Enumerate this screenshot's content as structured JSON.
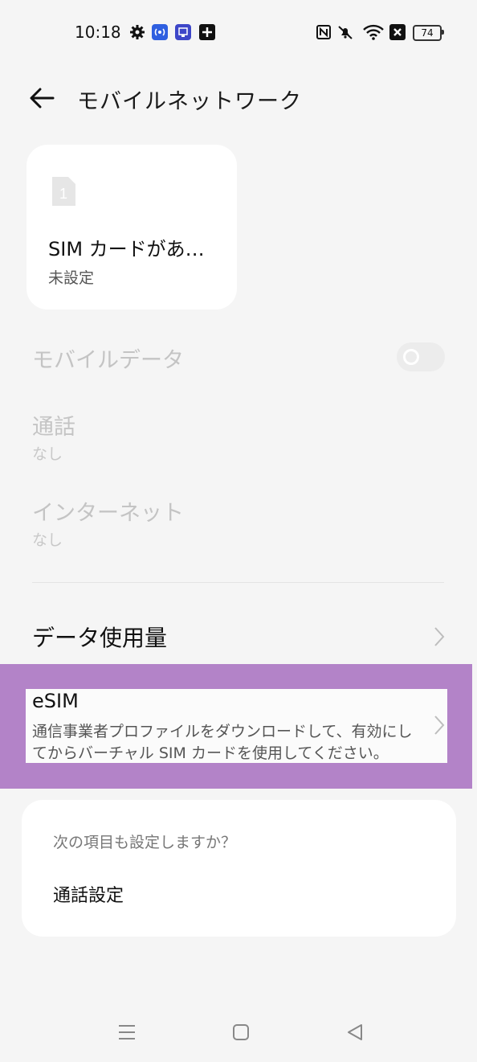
{
  "status_bar": {
    "time": "10:18",
    "battery": "74",
    "icons": [
      "gear-icon",
      "app-broadcast-icon",
      "app-cast-icon",
      "plus-box-icon",
      "nfc-icon",
      "mute-icon",
      "wifi-icon",
      "x-box-icon",
      "battery-icon"
    ]
  },
  "header": {
    "title": "モバイルネットワーク",
    "back_icon": "back-arrow-icon"
  },
  "sim_card": {
    "slot_number": "1",
    "name": "SIM カードがあ…",
    "status": "未設定"
  },
  "rows": {
    "mobile_data": {
      "label": "モバイルデータ",
      "enabled": false,
      "toggle_on": false
    },
    "call": {
      "label": "通話",
      "value": "なし"
    },
    "internet": {
      "label": "インターネット",
      "value": "なし"
    },
    "data_usage": {
      "label": "データ使用量"
    },
    "esim": {
      "title": "eSIM",
      "description": "通信事業者プロファイルをダウンロードして、有効にしてからバーチャル SIM カードを使用してください。"
    }
  },
  "suggestion": {
    "question": "次の項目も設定しますか？",
    "item": "通話設定"
  },
  "colors": {
    "background": "#f5f5f5",
    "card": "#ffffff",
    "highlight": "#b383c8",
    "disabled_text": "#c4c4c4"
  },
  "nav_bar": [
    "menu-icon",
    "home-icon",
    "back-triangle-icon"
  ]
}
